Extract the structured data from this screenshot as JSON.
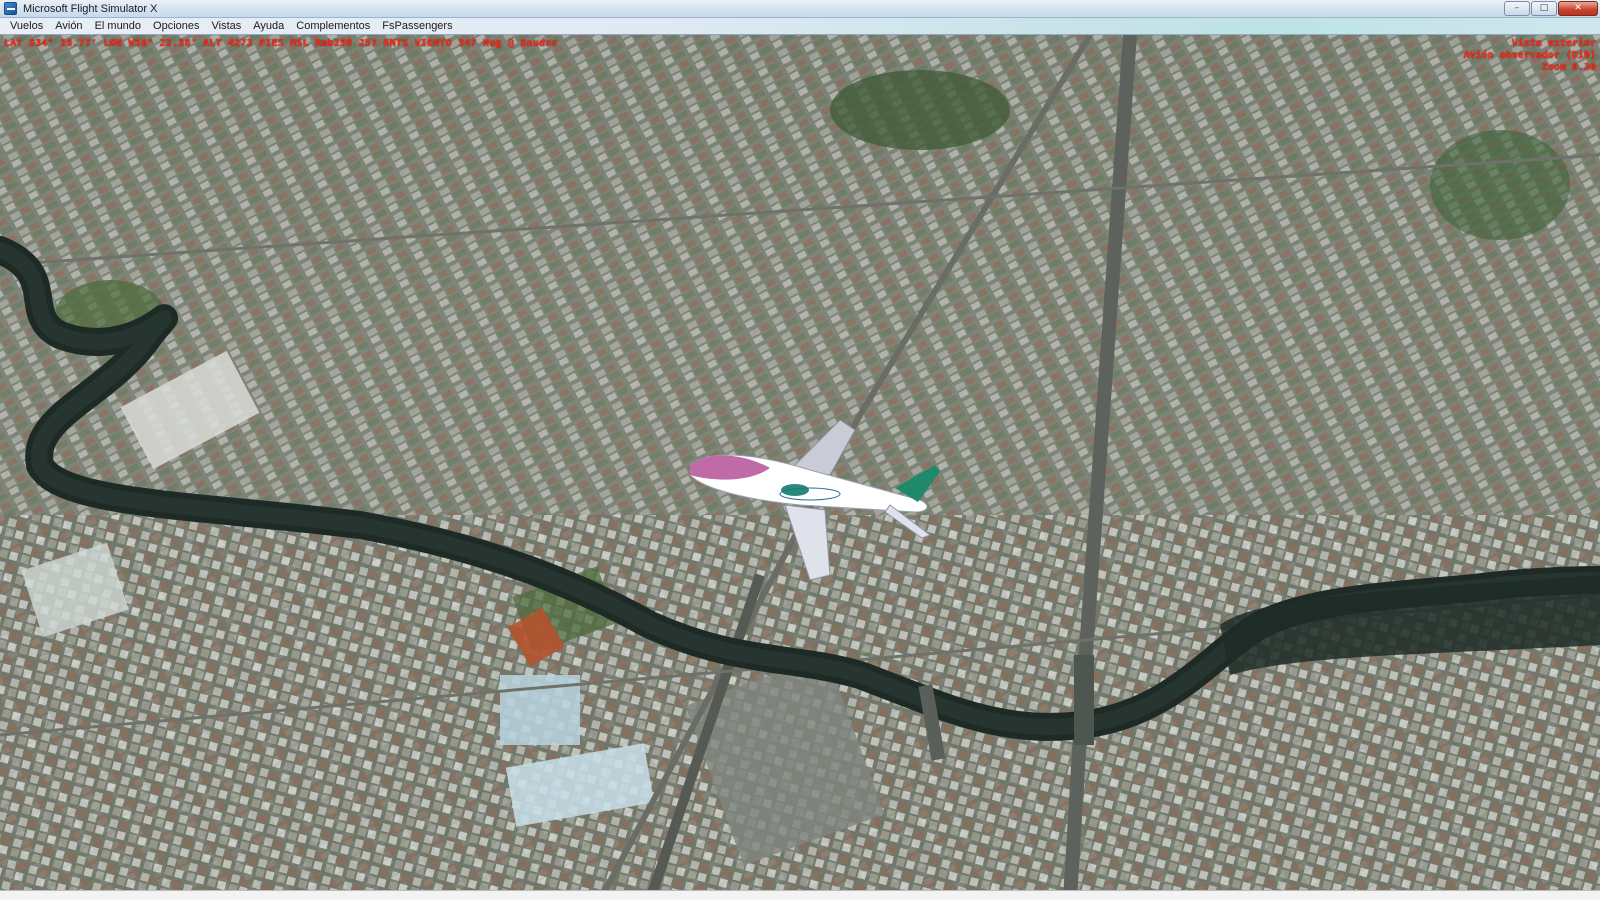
{
  "window": {
    "title": "Microsoft Flight Simulator X",
    "controls": {
      "minimize": "–",
      "maximize": "□",
      "close": "✕"
    }
  },
  "menu": {
    "items": [
      "Vuelos",
      "Avión",
      "El mundo",
      "Opciones",
      "Vistas",
      "Ayuda",
      "Complementos",
      "FsPassengers"
    ]
  },
  "hud": {
    "left_line": "LAT S34° 38.77'  LON W58° 22.38'  ALT 4273 PIES MSL  Rmb250  257 KNTS  VIENTO 347 Nug @ 8nudos",
    "right_lines": [
      "Vista exterior",
      "Avión observador (Dib)",
      "Zoom 0.30"
    ]
  },
  "colors": {
    "hud_text": "#ff2a1a",
    "river": "#1e2a26",
    "titlebar": "#d6e3f1",
    "aircraft_livery": [
      "#ffffff",
      "#c06aa8",
      "#1f8a6a"
    ]
  },
  "icons": {
    "app": "flight-simulator-app-icon",
    "minimize": "minimize-icon",
    "maximize": "maximize-icon",
    "close": "close-icon"
  }
}
